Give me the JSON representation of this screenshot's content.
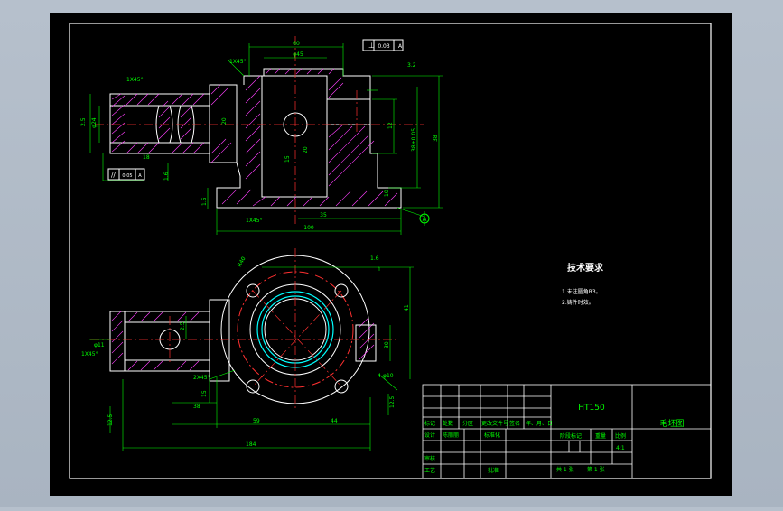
{
  "title_block": {
    "material": "HT150",
    "drawing_name": "毛坯图",
    "row_labels": [
      "标记",
      "处数",
      "分区",
      "更改文件号",
      "签名",
      "年、月、日"
    ],
    "design": "设计",
    "drawn": "陈丽丽",
    "standardized": "标准化",
    "review": "审核",
    "process": "工艺",
    "approve": "批准",
    "stage_mark": "阶段标记",
    "weight": "重量",
    "scale_label": "比例",
    "scale": "4:1",
    "sheets": "共 1 张",
    "sheet_no": "第 1 张"
  },
  "tech_requirements": {
    "title": "技术要求",
    "items": [
      "1.未注圆角R3。",
      "2.铸件时效。"
    ]
  },
  "dims_front": {
    "top_width": "60",
    "chamfer_tl": "1X45°",
    "chamfer_main": "1X45°",
    "chamfer_bot": "1X45°",
    "bore_top": "φ45",
    "tol_frame": "0.03",
    "rough_tr": "3.2",
    "left_ht": "2.5",
    "height_total": "38",
    "height_r": "38±0.05",
    "d_bore": "20",
    "base_w": "100",
    "base_r": "35",
    "small_l": "1.6",
    "side_tol": "0.05",
    "side_dim": "12",
    "bot_l": "18",
    "dia_left": "φ24",
    "bot_step": "1.5",
    "h_small": "15",
    "h_base": "10",
    "datum": "A"
  },
  "dims_top": {
    "ring_dim": "R40",
    "rough": "1.6",
    "side_dim": "41",
    "rt_dim": "30",
    "bolt_holes": "4-φ10",
    "r_bot": "12.5",
    "left_dia": "φ11",
    "left_chamfer": "1X45°",
    "small_depth": "2.5",
    "chamfer2": "2X45°",
    "w38": "38",
    "w59": "59",
    "w44": "44",
    "w184": "184",
    "left_h": "12.5",
    "h25": "2.5",
    "r15": "15"
  }
}
